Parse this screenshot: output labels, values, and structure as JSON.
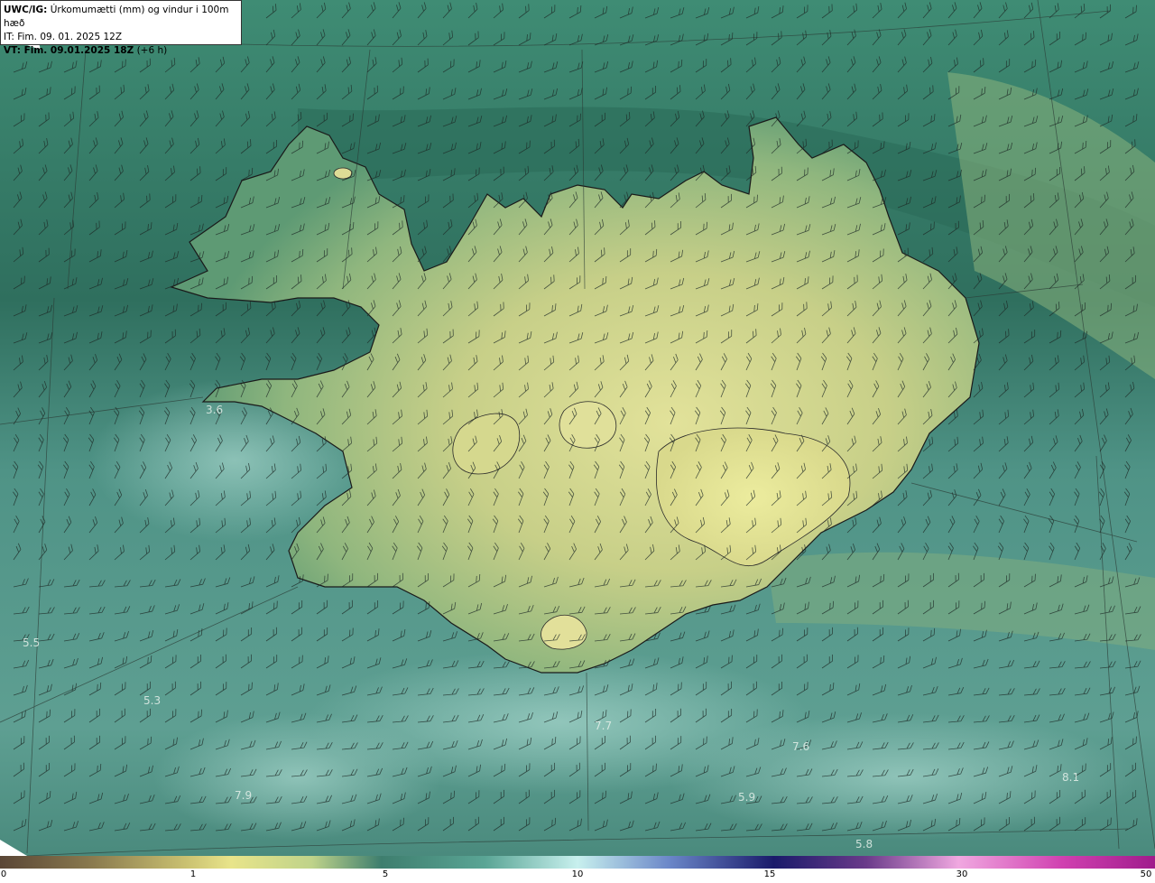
{
  "header": {
    "model": "UWC/IG:",
    "title": "Úrkomumætti (mm) og vindur i 100m hæð",
    "init_time": "IT: Fim. 09. 01. 2025 12Z",
    "valid_prefix": "VT: Fim. 09.01.2025 18Z",
    "valid_suffix": "(+6 h)"
  },
  "value_labels": [
    "3.6",
    "5.5",
    "5.3",
    "7.9",
    "7.7",
    "7.6",
    "5.9",
    "5.8",
    "8.1"
  ],
  "colorbar": {
    "ticks": [
      "0",
      "1",
      "5",
      "10",
      "15",
      "30",
      "50"
    ],
    "colors": [
      "#5a4636",
      "#8a7a4e",
      "#c9c070",
      "#e8e48a",
      "#bfd38a",
      "#6ea888",
      "#3e7e6e",
      "#5aa595",
      "#9ad8cc",
      "#c8f0ee",
      "#6a86c8",
      "#2c2c9a",
      "#1a1a6a",
      "#6a3a8a",
      "#b87ac8",
      "#f0a8e0",
      "#d040b0",
      "#a01c8c"
    ]
  },
  "colors": {
    "ocean": "#4f9386",
    "ocean_dark": "#2f6f5e",
    "land_low": "#4f8f6f",
    "land_high": "#d7da8e",
    "coast": "#1a1a1a"
  }
}
